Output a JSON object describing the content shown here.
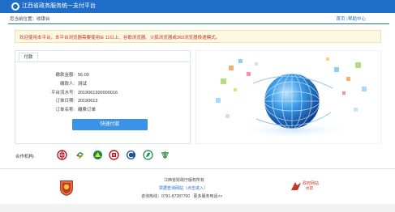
{
  "header": {
    "title": "江西省政务服务统一支付平台"
  },
  "breadcrumb": {
    "text": "您当前位置：收银台"
  },
  "toplinks": {
    "home": "首页",
    "sep": "|",
    "help": "帮助中心"
  },
  "notice": {
    "text": "欢迎使用本平台，本平台浏览器需要使用IE 11以上、谷歌浏览器、火狐浏览器或360浏览器极速模式。"
  },
  "payment": {
    "tab_label": "付款",
    "rows": [
      {
        "label": "缴款金额:",
        "value": "56.00"
      },
      {
        "label": "缴款人:",
        "value": "测试"
      },
      {
        "label": "平台流水号:",
        "value": "2019061300000016"
      },
      {
        "label": "订单日期:",
        "value": "20190613"
      },
      {
        "label": "订单名称:",
        "value": "缴费订单"
      }
    ],
    "button_label": "快速付款"
  },
  "partners": {
    "label": "合作机构:",
    "items": [
      {
        "icon": "boc-icon",
        "color": "#b81c22"
      },
      {
        "icon": "bank-swirl-icon",
        "color": "#2b7a3b"
      },
      {
        "icon": "abc-icon",
        "color": "#1a8a4a"
      },
      {
        "icon": "icbc-icon",
        "color": "#c8161d"
      },
      {
        "icon": "ccb-icon",
        "color": "#1c4fa1"
      },
      {
        "icon": "bank-leaf-icon",
        "color": "#1a8a4a"
      },
      {
        "icon": "postal-icon",
        "color": "#2e8b3e"
      }
    ]
  },
  "footer": {
    "owner": "江西省财政厅版权所有",
    "link": "票据查询网站（点击进入）",
    "phone": "咨询热线：0791-87287700",
    "more": "更多服务电话>>",
    "gov_logo_text": "政府网站",
    "gov_logo_sub": "找错"
  },
  "colors": {
    "primary": "#1f6ec9",
    "button": "#3a93e6",
    "notice_text": "#c0392b"
  }
}
